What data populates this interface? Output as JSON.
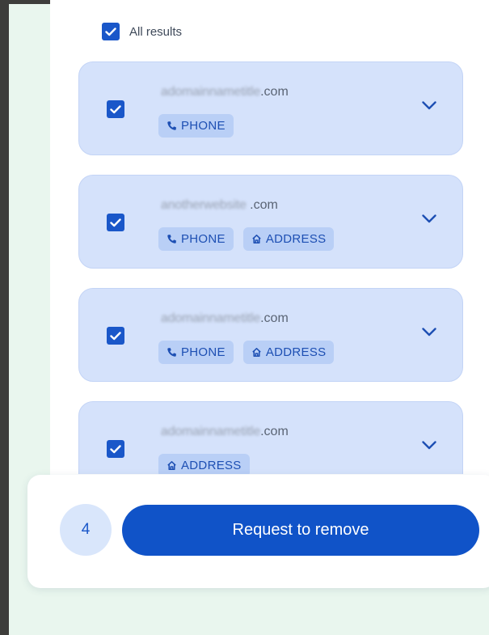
{
  "all_results": {
    "label": "All results",
    "checked": true
  },
  "results": [
    {
      "domain_blurred": "adomainnametitle",
      "domain_suffix": ".com",
      "tags": [
        {
          "icon": "phone-icon",
          "label": "PHONE"
        }
      ]
    },
    {
      "domain_blurred": "anotherwebsite",
      "domain_suffix": " .com",
      "tags": [
        {
          "icon": "phone-icon",
          "label": "PHONE"
        },
        {
          "icon": "home-icon",
          "label": "ADDRESS"
        }
      ]
    },
    {
      "domain_blurred": "adomainnametitle",
      "domain_suffix": ".com",
      "tags": [
        {
          "icon": "phone-icon",
          "label": "PHONE"
        },
        {
          "icon": "home-icon",
          "label": "ADDRESS"
        }
      ]
    },
    {
      "domain_blurred": "adomainnametitle",
      "domain_suffix": ".com",
      "tags": [
        {
          "icon": "home-icon",
          "label": "ADDRESS"
        }
      ]
    }
  ],
  "footer": {
    "count": "4",
    "button_label": "Request to remove"
  },
  "colors": {
    "accent": "#1053c8",
    "card": "#d5e2fb",
    "chip": "#b9cff6",
    "page_bg": "#e9f6ee"
  }
}
